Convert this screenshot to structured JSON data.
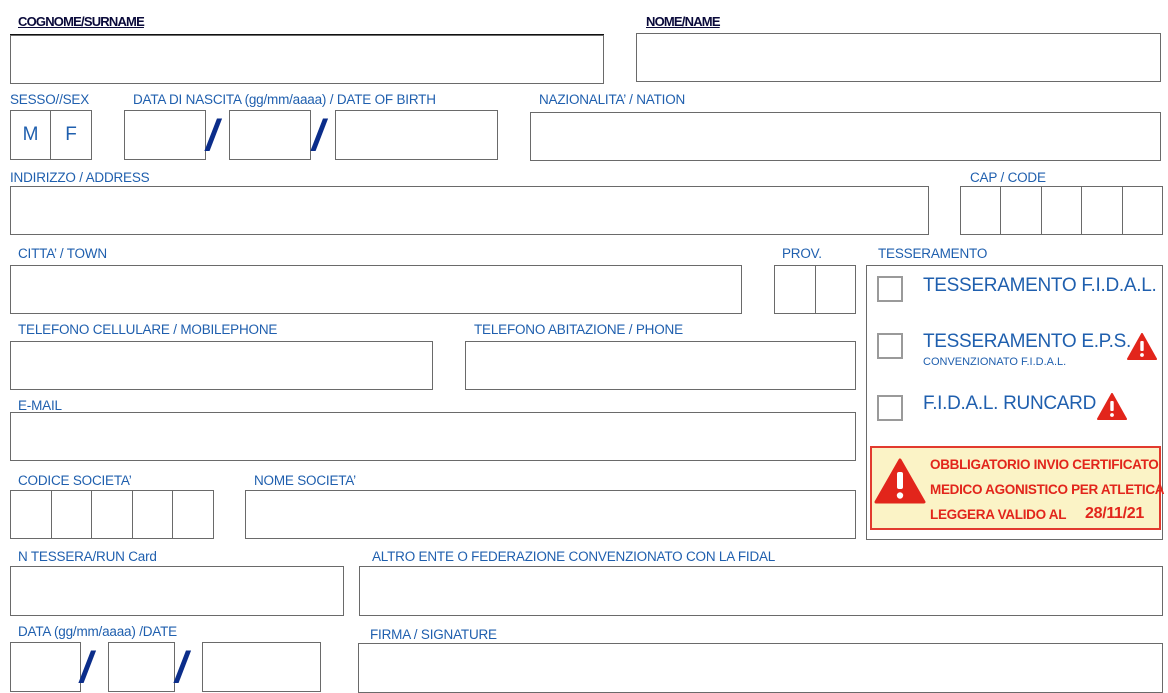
{
  "labels": {
    "surname": "COGNOME/SURNAME",
    "name": "NOME/NAME",
    "sex": "SESSO//SEX",
    "birth": "DATA DI NASCITA (gg/mm/aaaa) / DATE OF BIRTH",
    "nation": "NAZIONALITA’ / NATION",
    "address": "INDIRIZZO / ADDRESS",
    "cap": "CAP / CODE",
    "town": "CITTA’ / TOWN",
    "prov": "PROV.",
    "membership": "TESSERAMENTO",
    "mobile": "TELEFONO CELLULARE / MOBILEPHONE",
    "phone": "TELEFONO ABITAZIONE / PHONE",
    "email": "E-MAIL",
    "club_code": "CODICE SOCIETA’",
    "club_name": "NOME SOCIETA’",
    "card": "N TESSERA/RUN Card",
    "other_body": "ALTRO ENTE O FEDERAZIONE CONVENZIONATO CON LA FIDAL",
    "date": "DATA (gg/mm/aaaa) /DATE",
    "signature": "FIRMA / SIGNATURE"
  },
  "sex_options": {
    "m": "M",
    "f": "F"
  },
  "slash": "/",
  "membership_options": [
    {
      "label": "TESSERAMENTO F.I.D.A.L.",
      "sub": ""
    },
    {
      "label": "TESSERAMENTO E.P.S.",
      "sub": "CONVENZIONATO F.I.D.A.L."
    },
    {
      "label": "F.I.D.A.L. RUNCARD",
      "sub": ""
    }
  ],
  "notice": {
    "line1": "OBBLIGATORIO INVIO  CERTIFICATO",
    "line2": "MEDICO  AGONISTICO PER ATLETICA",
    "line3": "LEGGERA VALIDO AL",
    "date": "28/11/21"
  },
  "colors": {
    "label": "#1f5fae",
    "warning": "#e2251b",
    "notice_bg": "#fbf3c6"
  },
  "icons": {
    "warning": "warning-triangle-icon"
  }
}
